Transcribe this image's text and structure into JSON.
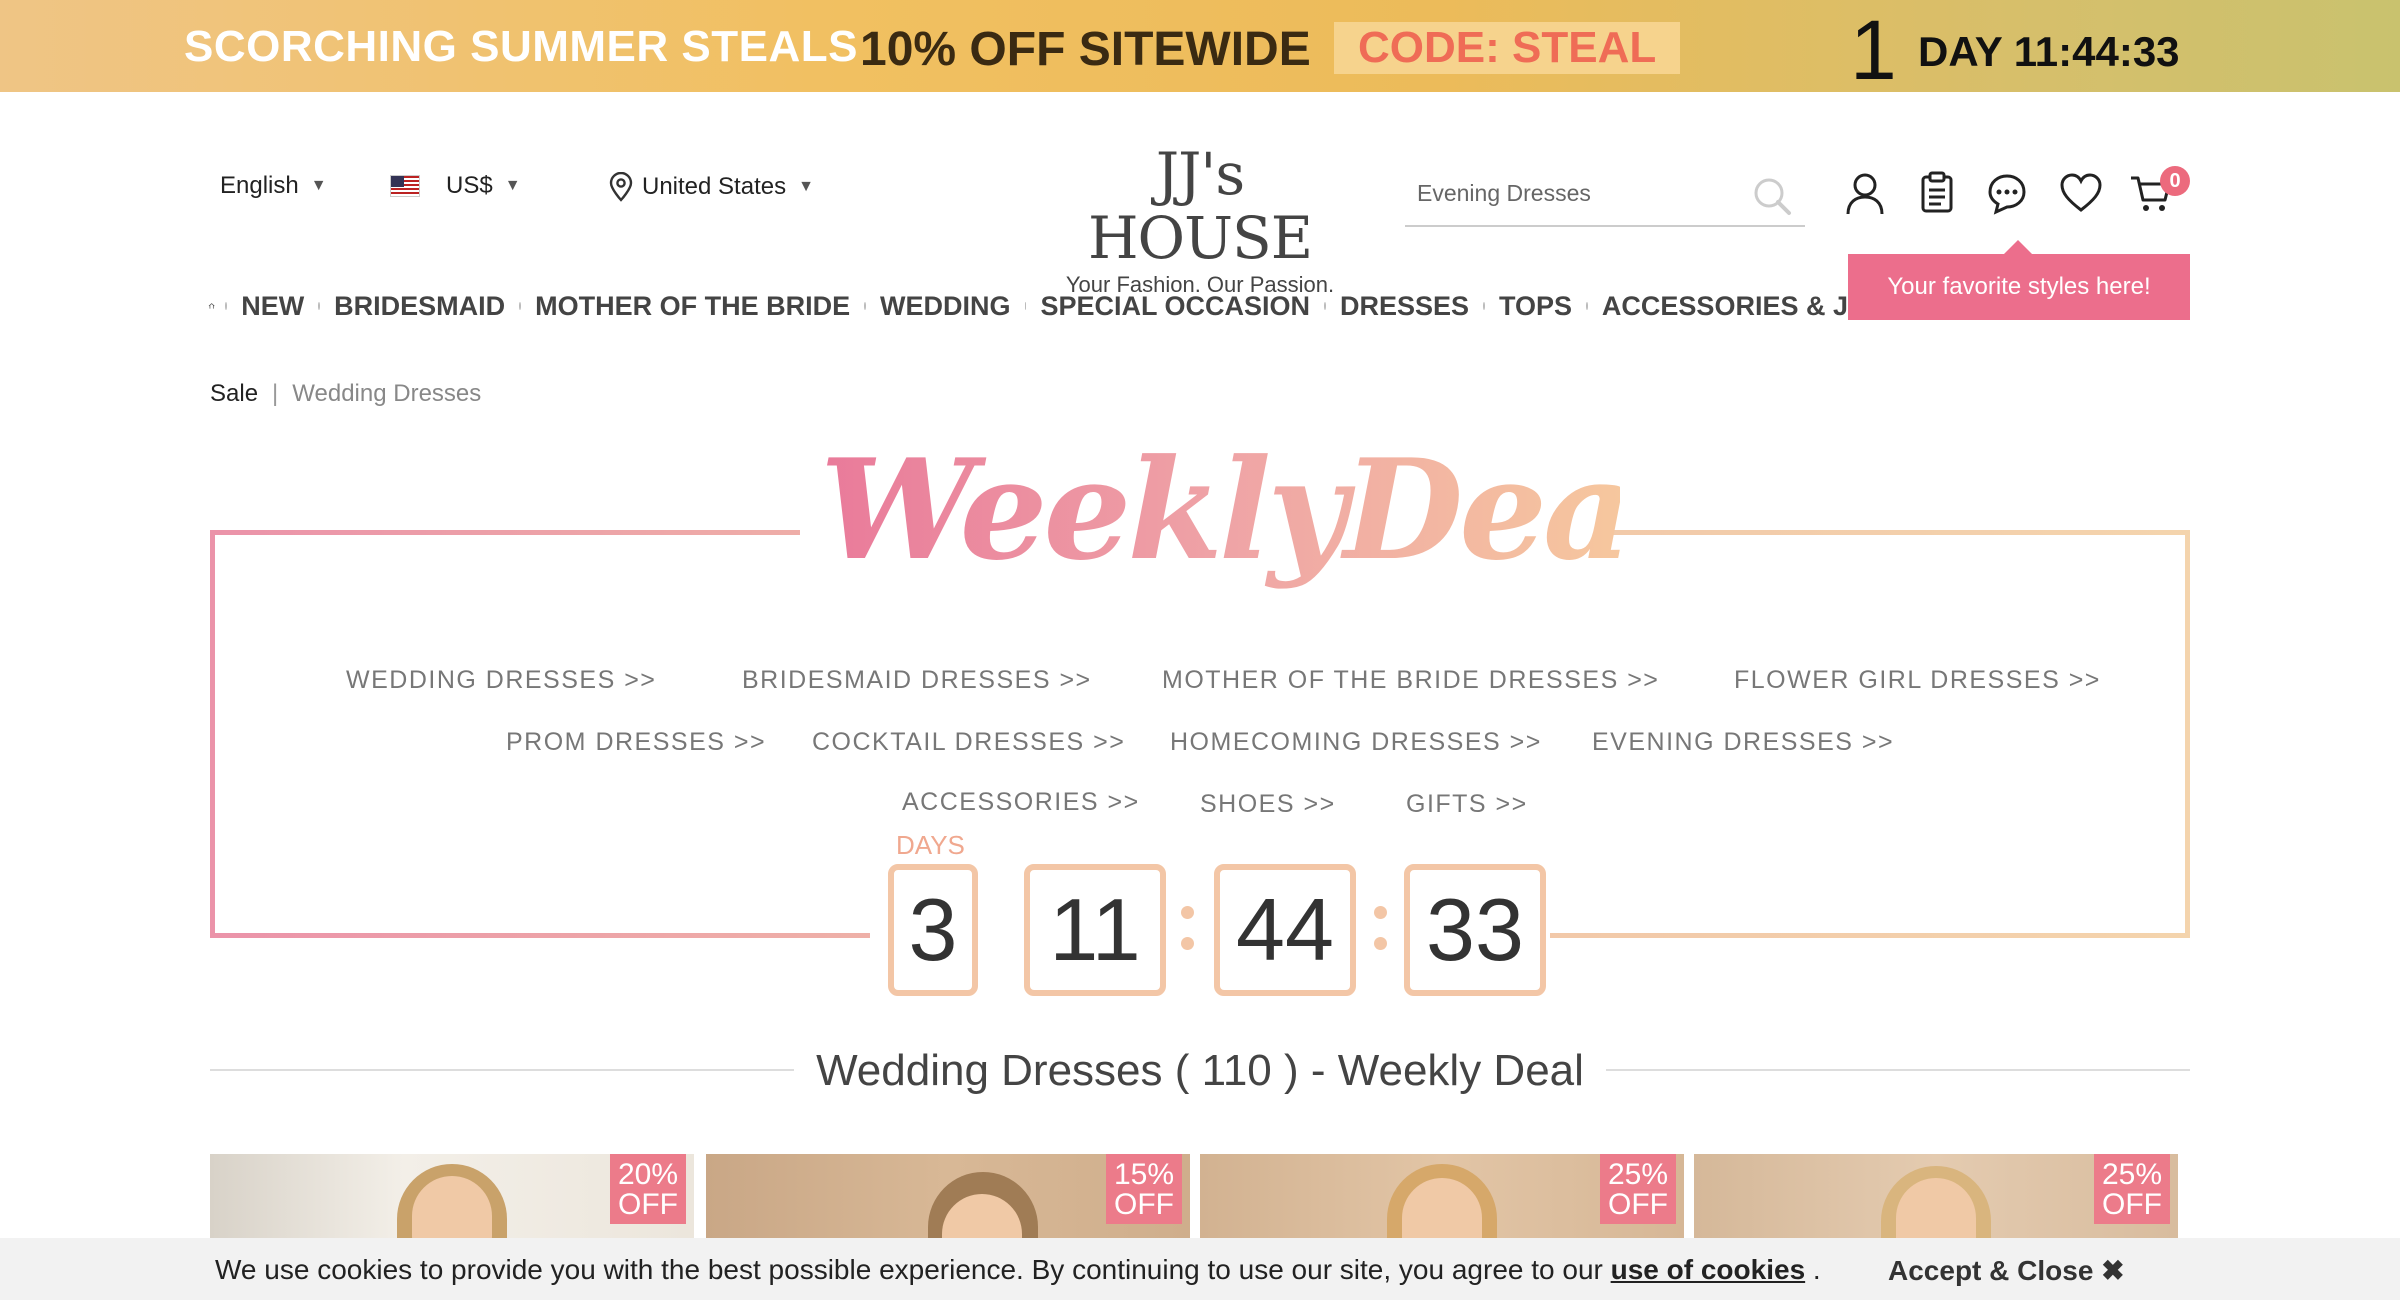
{
  "promo": {
    "headline": "SCORCHING SUMMER STEALS",
    "offer": "10% OFF SITEWIDE",
    "code": "CODE: STEAL",
    "countdown_days": "1",
    "countdown_rest": "DAY 11:44:33"
  },
  "header": {
    "language": "English",
    "currency": "US$",
    "country": "United States",
    "logo_name": "JJ's HOUSE",
    "logo_tagline": "Your Fashion. Our Passion.",
    "search_placeholder": "Evening Dresses",
    "cart_count": "0",
    "favorite_tooltip": "Your favorite styles here!"
  },
  "nav": {
    "items": [
      "NEW",
      "BRIDESMAID",
      "MOTHER OF THE BRIDE",
      "WEDDING",
      "SPECIAL OCCASION",
      "DRESSES",
      "TOPS",
      "ACCESSORIES & J"
    ]
  },
  "breadcrumb": {
    "first": "Sale",
    "separator": "|",
    "current": "Wedding Dresses"
  },
  "deal": {
    "title": "WeeklyDeal",
    "links": [
      "WEDDING DRESSES >>",
      "BRIDESMAID DRESSES >>",
      "MOTHER OF THE BRIDE DRESSES >>",
      "FLOWER GIRL DRESSES >>",
      "PROM DRESSES >>",
      "COCKTAIL DRESSES >>",
      "HOMECOMING DRESSES >>",
      "EVENING DRESSES >>",
      "ACCESSORIES >>",
      "SHOES >>",
      "GIFTS >>"
    ],
    "days_label": "DAYS",
    "days": "3",
    "hours": "11",
    "minutes": "44",
    "seconds": "33",
    "section_title": "Wedding Dresses ( 110 ) - Weekly Deal"
  },
  "products": [
    {
      "discount_pct": "20%",
      "discount_word": "OFF"
    },
    {
      "discount_pct": "15%",
      "discount_word": "OFF"
    },
    {
      "discount_pct": "25%",
      "discount_word": "OFF"
    },
    {
      "discount_pct": "25%",
      "discount_word": "OFF"
    }
  ],
  "cookie": {
    "message": "We use cookies to provide you with the best possible experience. By continuing to use our site, you agree to our ",
    "link": "use of cookies",
    "period": " .",
    "accept": "Accept & Close ✖"
  },
  "colors": {
    "accent_pink": "#ec6e8c",
    "deal_gold": "#f3c6a6"
  }
}
